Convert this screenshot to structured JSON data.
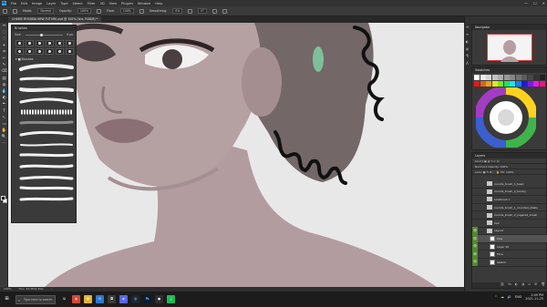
{
  "app": {
    "logo": "Ps",
    "menu": [
      "File",
      "Edit",
      "Image",
      "Layer",
      "Type",
      "Select",
      "Filter",
      "3D",
      "View",
      "Plugins",
      "Window",
      "Help"
    ],
    "window_controls": [
      "—",
      "☐",
      "✕"
    ]
  },
  "options": {
    "mode_label": "Mode:",
    "mode_value": "Normal",
    "opacity_label": "Opacity:",
    "opacity_value": "100%",
    "flow_label": "Flow:",
    "flow_value": "100%",
    "smoothing_label": "Smoothing:",
    "smoothing_value": "0%",
    "angle_value": "0°"
  },
  "document": {
    "tab_title": "CHARIE RHONDA NEW FUTURE.psd @ 100% (line, RGB/8) *"
  },
  "tools": [
    "↔",
    "⬚",
    "◌",
    "✦",
    "⌗",
    "✂",
    "✎",
    "⌫",
    "▤",
    "◍",
    "💧",
    "◐",
    "✒",
    "T",
    "↖",
    "▭",
    "✋",
    "🔍",
    "⋯"
  ],
  "brushes_panel": {
    "title": "Brushes",
    "size_label": "Size:",
    "size_value": "9 px",
    "folder_label": "▾ ■ Brushes"
  },
  "status": {
    "zoom": "100%",
    "doc_info": "Doc: 34.3M/1.60G",
    "arrow": "›"
  },
  "navigator": {
    "title": "Navigator"
  },
  "swatches": {
    "title": "Swatches"
  },
  "layers": {
    "title": "Layers",
    "kind_row": "Kind  ▾   ▣  ◍  T  ▭  ⛭",
    "blend_row": "Normal  ▾     Opacity: 100%",
    "lock_row": "Lock: ▦ ✎ ✥ ⬚ 🔒    Fill: 100%",
    "rows": [
      {
        "name": "rounds_brush_1_basic",
        "eye": "",
        "type": "folder",
        "selected": false
      },
      {
        "name": "rounds_brush_2_tonary",
        "eye": "",
        "type": "folder",
        "selected": false
      },
      {
        "name": "Linebrush II",
        "eye": "",
        "type": "folder",
        "selected": false
      },
      {
        "name": "rounds_brush_1_rounded_shelly",
        "eye": "",
        "type": "folder",
        "selected": false
      },
      {
        "name": "rounds_brush_2_sugared_brush",
        "eye": "",
        "type": "folder",
        "selected": false
      },
      {
        "name": "hair",
        "eye": "",
        "type": "folder",
        "selected": false
      },
      {
        "name": "Layout",
        "eye": "👁",
        "type": "folder",
        "selected": false
      },
      {
        "name": "Line",
        "eye": "👁",
        "type": "layer",
        "selected": true
      },
      {
        "name": "Layer 20",
        "eye": "👁",
        "type": "layer",
        "selected": false
      },
      {
        "name": "Face",
        "eye": "👁",
        "type": "layer",
        "selected": false
      },
      {
        "name": "Sketch",
        "eye": "👁",
        "type": "layer",
        "selected": false
      }
    ],
    "bottom_icons": [
      "⛓",
      "fx",
      "◐",
      "◑",
      "▭",
      "⊞",
      "🗑"
    ]
  },
  "taskbar": {
    "start": "⊞",
    "search_placeholder": "Type here to search",
    "apps": [
      {
        "name": "task-view",
        "glyph": "⧉",
        "color": "#1c1c1c"
      },
      {
        "name": "chrome",
        "glyph": "◉",
        "color": "#db4437"
      },
      {
        "name": "file-explorer",
        "glyph": "▤",
        "color": "#e2b33b"
      },
      {
        "name": "mail",
        "glyph": "✉",
        "color": "#2b78d4"
      },
      {
        "name": "store",
        "glyph": "◘",
        "color": "#3b3b3b"
      },
      {
        "name": "discord",
        "glyph": "◈",
        "color": "#5865f2"
      },
      {
        "name": "steam",
        "glyph": "◎",
        "color": "#1b2838"
      },
      {
        "name": "photoshop",
        "glyph": "Ps",
        "color": "#001e36"
      },
      {
        "name": "obs",
        "glyph": "●",
        "color": "#302e31"
      },
      {
        "name": "spotify",
        "glyph": "♫",
        "color": "#1db954"
      }
    ],
    "tray_icons": [
      "^",
      "☁",
      "🔊",
      "ENG"
    ],
    "time": "2:49 PM",
    "date": "2021-11-25"
  },
  "colors": {
    "accent_ps": "#31a8ff",
    "layer_visible": "#4f8a2b",
    "skin": "#b39c9f",
    "hair": "#5e5050",
    "canvas_bg": "#e9e8e9"
  }
}
